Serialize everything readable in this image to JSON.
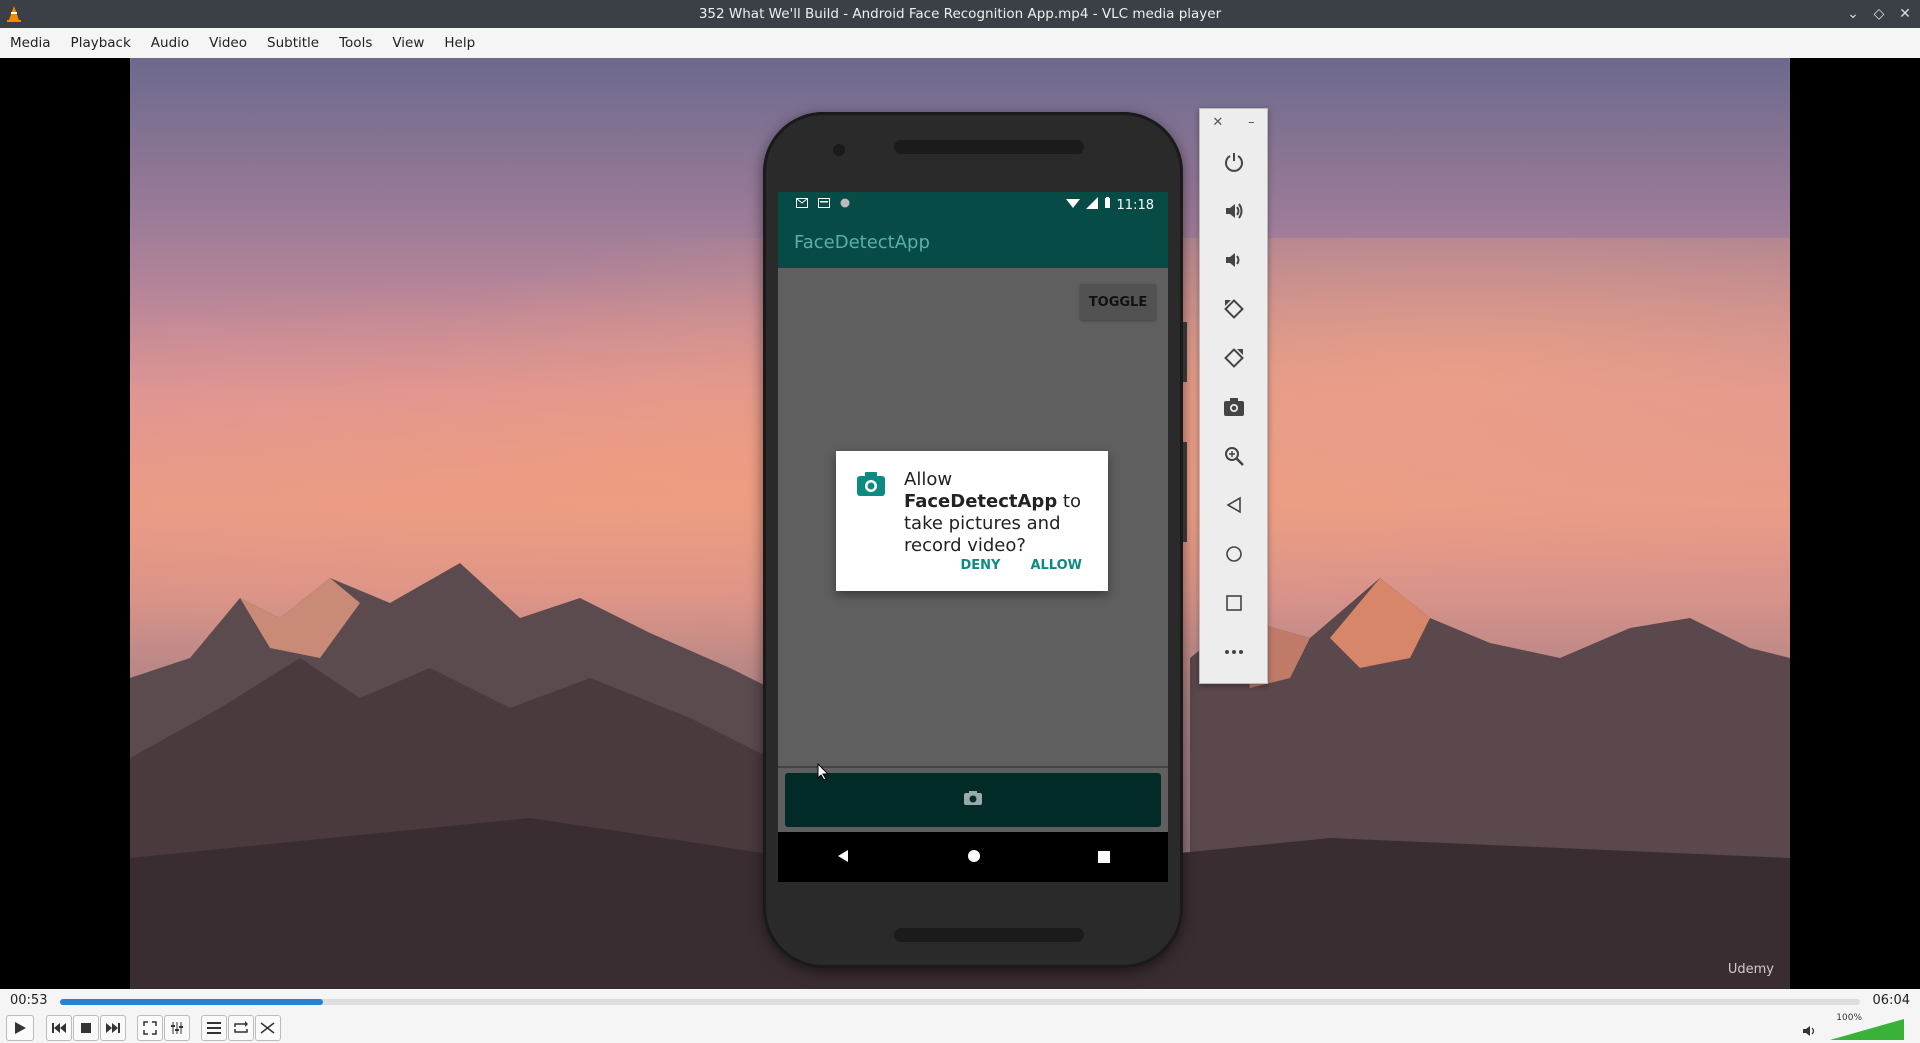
{
  "window": {
    "title": "352 What We'll Build - Android Face Recognition App.mp4 - VLC media player"
  },
  "menu": {
    "items": [
      "Media",
      "Playback",
      "Audio",
      "Video",
      "Subtitle",
      "Tools",
      "View",
      "Help"
    ]
  },
  "phone": {
    "status_time": "11:18",
    "app_title": "FaceDetectApp",
    "toggle_label": "TOGGLE",
    "dialog": {
      "prefix": "Allow ",
      "app_name": "FaceDetectApp",
      "suffix": " to take pictures and record video?",
      "deny_label": "DENY",
      "allow_label": "ALLOW"
    }
  },
  "emulator_panel": {
    "icons": [
      "power-icon",
      "volume-up-icon",
      "volume-down-icon",
      "rotate-left-icon",
      "rotate-right-icon",
      "screenshot-icon",
      "zoom-icon",
      "back-icon",
      "home-icon",
      "overview-icon",
      "more-icon"
    ]
  },
  "watermark": "Udemy",
  "player": {
    "elapsed": "00:53",
    "total": "06:04",
    "progress_fraction": 0.146,
    "volume_label": "100%",
    "volume_fraction": 1.0,
    "accent_color": "#2a7fd0"
  }
}
